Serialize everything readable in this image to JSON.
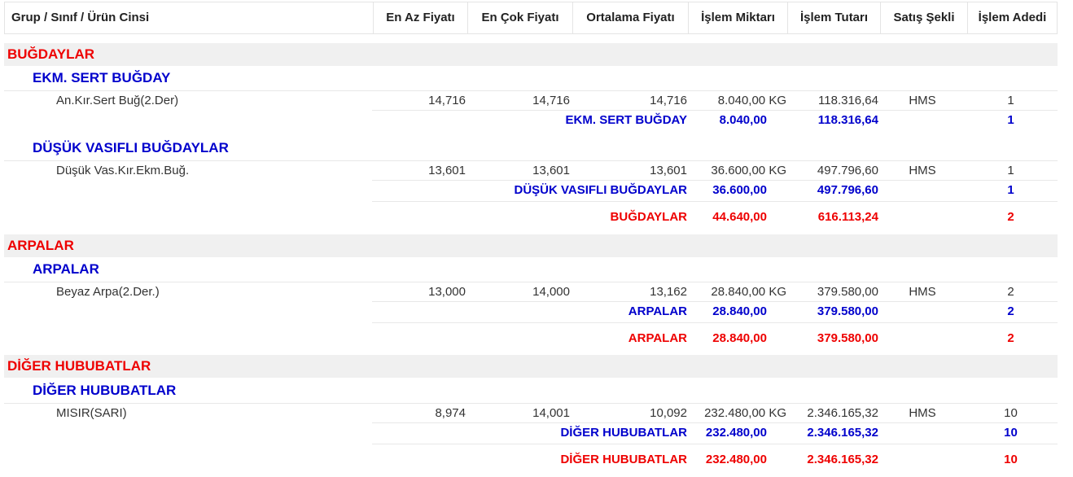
{
  "header": {
    "columns": [
      "Grup / Sınıf / Ürün Cinsi",
      "En Az Fiyatı",
      "En Çok Fiyatı",
      "Ortalama Fiyatı",
      "İşlem Miktarı",
      "İşlem Tutarı",
      "Satış Şekli",
      "İşlem Adedi"
    ]
  },
  "groups": [
    {
      "name": "BUĞDAYLAR",
      "subgroups": [
        {
          "name": "EKM. SERT BUĞDAY",
          "item": {
            "name": "An.Kır.Sert Buğ(2.Der)",
            "min": "14,716",
            "max": "14,716",
            "avg": "14,716",
            "qty": "8.040,00 KG",
            "amount": "118.316,64",
            "sale": "HMS",
            "count": "1"
          },
          "subtotal": {
            "label": "EKM. SERT BUĞDAY",
            "qty": "8.040,00",
            "amount": "118.316,64",
            "count": "1"
          }
        },
        {
          "name": "DÜŞÜK VASIFLI BUĞDAYLAR",
          "item": {
            "name": "Düşük Vas.Kır.Ekm.Buğ.",
            "min": "13,601",
            "max": "13,601",
            "avg": "13,601",
            "qty": "36.600,00 KG",
            "amount": "497.796,60",
            "sale": "HMS",
            "count": "1"
          },
          "subtotal": {
            "label": "DÜŞÜK VASIFLI BUĞDAYLAR",
            "qty": "36.600,00",
            "amount": "497.796,60",
            "count": "1"
          }
        }
      ],
      "total": {
        "label": "BUĞDAYLAR",
        "qty": "44.640,00",
        "amount": "616.113,24",
        "count": "2"
      }
    },
    {
      "name": "ARPALAR",
      "subgroups": [
        {
          "name": "ARPALAR",
          "item": {
            "name": "Beyaz Arpa(2.Der.)",
            "min": "13,000",
            "max": "14,000",
            "avg": "13,162",
            "qty": "28.840,00 KG",
            "amount": "379.580,00",
            "sale": "HMS",
            "count": "2"
          },
          "subtotal": {
            "label": "ARPALAR",
            "qty": "28.840,00",
            "amount": "379.580,00",
            "count": "2"
          }
        }
      ],
      "total": {
        "label": "ARPALAR",
        "qty": "28.840,00",
        "amount": "379.580,00",
        "count": "2"
      }
    },
    {
      "name": "DİĞER HUBUBATLAR",
      "subgroups": [
        {
          "name": "DİĞER HUBUBATLAR",
          "item": {
            "name": "MISIR(SARI)",
            "min": "8,974",
            "max": "14,001",
            "avg": "10,092",
            "qty": "232.480,00 KG",
            "amount": "2.346.165,32",
            "sale": "HMS",
            "count": "10"
          },
          "subtotal": {
            "label": "DİĞER HUBUBATLAR",
            "qty": "232.480,00",
            "amount": "2.346.165,32",
            "count": "10"
          }
        }
      ],
      "total": {
        "label": "DİĞER HUBUBATLAR",
        "qty": "232.480,00",
        "amount": "2.346.165,32",
        "count": "10"
      }
    }
  ]
}
